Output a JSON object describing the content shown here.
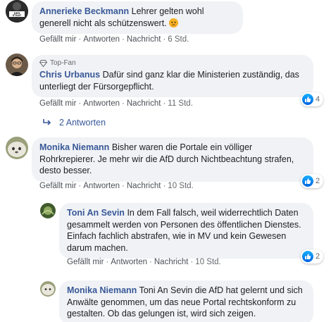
{
  "actions": {
    "like": "Gefällt mir",
    "reply": "Antworten",
    "message": "Nachricht",
    "sep": "·"
  },
  "comments": [
    {
      "author": "Annerieke Beckmann",
      "text": "Lehrer gelten wohl generell nicht als schützenswert.",
      "time": "6 Std.",
      "avatar_text": "DER STAAT"
    },
    {
      "badge": "Top-Fan",
      "author": "Chris Urbanus",
      "text": "Dafür sind ganz klar die Ministerien zuständig, das unterliegt der Fürsorgepflicht.",
      "time": "11 Std.",
      "likes": "4"
    },
    {
      "author": "Monika Niemann",
      "text": "Bisher waren die Portale ein völliger Rohrkrepierer. Je mehr wir die AfD durch Nichtbeachtung strafen, desto besser.",
      "time": "10 Std.",
      "likes": "2"
    },
    {
      "author": "Toni An Sevin",
      "text": "In dem Fall falsch, weil widerrechtlich Daten gesammelt werden von Personen des öffentlichen Dienstes. Einfach fachlich abstrafen, wie in MV und kein Gewesen darum machen.",
      "time": "10 Std.",
      "likes": "2"
    },
    {
      "author": "Monika Niemann",
      "text": "Toni An Sevin die AfD hat gelernt und sich Anwälte genommen, um das neue Portal rechtskonform zu gestalten. Ob das gelungen ist, wird sich zeigen."
    }
  ],
  "replies_link": "2 Antworten",
  "colors": {
    "link": "#385898",
    "bubble": "#f0f2f5",
    "meta": "#65676b",
    "like": "#1877f2"
  }
}
